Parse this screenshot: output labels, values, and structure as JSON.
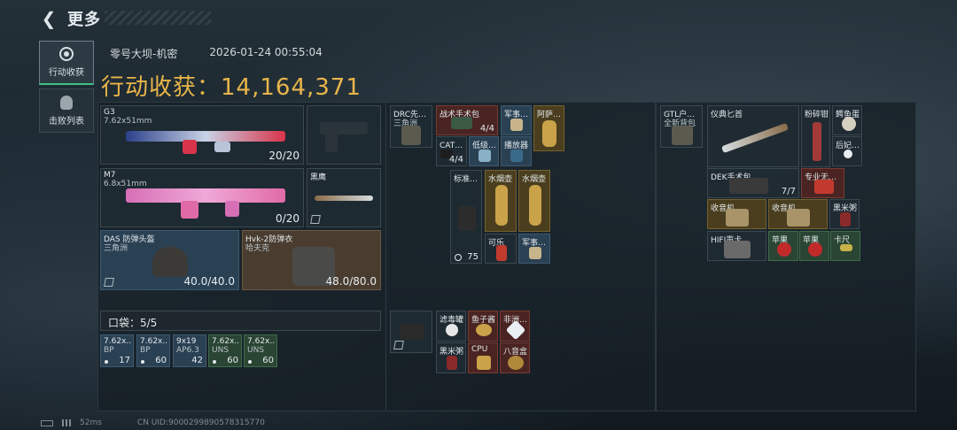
{
  "header": {
    "title": "更多"
  },
  "side": {
    "tab_loot": "行动收获",
    "tab_kills": "击败列表"
  },
  "match": {
    "map": "零号大坝-机密",
    "datetime": "2026-01-24 00:55:04"
  },
  "loot": {
    "label": "行动收获：",
    "value": "14,164,371"
  },
  "weapons": {
    "g3": {
      "name": "G3",
      "ammo_type": "7.62x51mm",
      "ammo": "20/20"
    },
    "m7": {
      "name": "M7",
      "ammo_type": "6.8x51mm",
      "ammo": "0/20"
    },
    "knife": {
      "name": "黑鹰"
    }
  },
  "armor": {
    "helmet": {
      "name": "DAS 防弹头盔",
      "origin": "三角洲",
      "durability": "40.0/40.0"
    },
    "vest": {
      "name": "Hvk-2防弹衣",
      "origin": "哈夫克",
      "durability": "48.0/80.0"
    }
  },
  "pocket": {
    "label": "口袋：5/5",
    "slots": [
      {
        "top": "7.62x..",
        "mid": "BP",
        "count": "17"
      },
      {
        "top": "7.62x..",
        "mid": "BP",
        "count": "60"
      },
      {
        "top": "9x19",
        "mid": "AP6.3",
        "count": "42"
      },
      {
        "top": "7.62x..",
        "mid": "UNS",
        "count": "60"
      },
      {
        "top": "7.62x..",
        "mid": "UNS",
        "count": "60"
      }
    ]
  },
  "rig": {
    "main": {
      "name": "DRC先进...",
      "sub": "三角洲"
    },
    "items": [
      {
        "name": "战术手术包",
        "count": "4/4"
      },
      {
        "name": "军事情..."
      },
      {
        "name": "阿萨拉..."
      },
      {
        "name": "CAT止...",
        "count": "4/4"
      },
      {
        "name": "低级燃..."
      },
      {
        "name": "播放器"
      }
    ],
    "mid": [
      {
        "name": "标准护...",
        "count": "75"
      },
      {
        "name": "水烟壶"
      },
      {
        "name": "水烟壶"
      },
      {
        "name": "可乐"
      },
      {
        "name": "军事情..."
      }
    ]
  },
  "pouch": {
    "items": [
      {
        "name": "滤毒罐"
      },
      {
        "name": "鱼子酱"
      },
      {
        "name": "非洲之..."
      },
      {
        "name": "黑米粥"
      },
      {
        "name": "CPU"
      },
      {
        "name": "八音盒"
      }
    ]
  },
  "backpack": {
    "main": {
      "name": "GTL户外...",
      "sub": "全新背包"
    },
    "items": [
      {
        "name": "仪典匕首"
      },
      {
        "name": "粉碎钳"
      },
      {
        "name": "鳄鱼蛋"
      },
      {
        "name": "后妃耳..."
      },
      {
        "name": "DEK手术包",
        "count": "7/7"
      },
      {
        "name": "专业无卡..."
      },
      {
        "name": "收音机"
      },
      {
        "name": "收音机"
      },
      {
        "name": "黑米粥"
      },
      {
        "name": "HIFI声卡"
      },
      {
        "name": "苹果"
      },
      {
        "name": "苹果"
      },
      {
        "name": "卡尺"
      }
    ]
  },
  "footer": {
    "ping": "52ms",
    "uid": "CN UID:9000299890578315770"
  },
  "colors": {
    "accent": "#e8b54a",
    "active_tab": "#3fbf86"
  }
}
